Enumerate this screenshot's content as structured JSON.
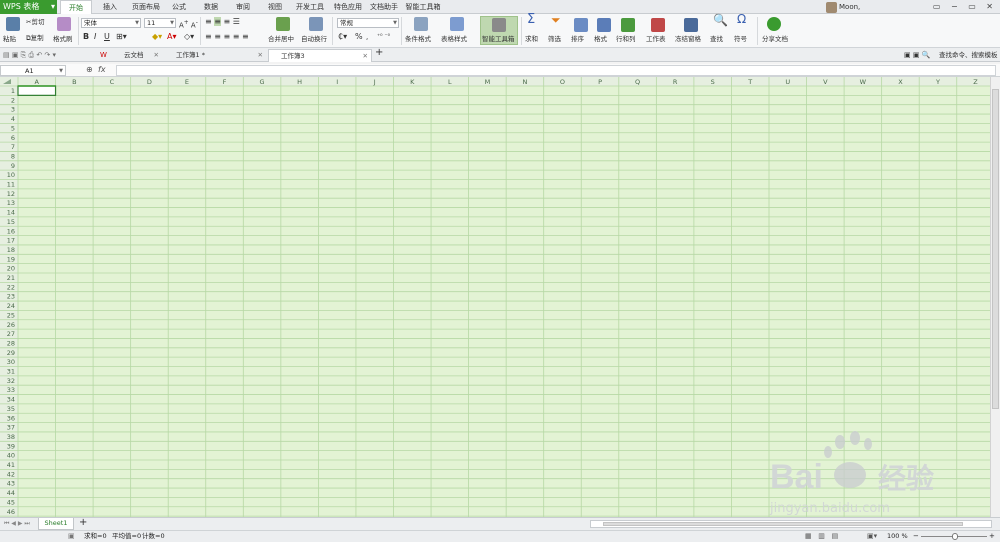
{
  "app": {
    "logo": "WPS 表格",
    "logo_dd": "▾"
  },
  "menu_tabs": [
    "开始",
    "插入",
    "页面布局",
    "公式",
    "数据",
    "审阅",
    "视图",
    "开发工具",
    "特色应用",
    "文档助手",
    "智能工具箱"
  ],
  "user": {
    "name": "Moon,"
  },
  "window_controls": "▭ − ▭ ✕",
  "ribbon": {
    "paste": "粘贴",
    "cut": "剪切",
    "copy": "复制",
    "format_painter": "格式刷",
    "font_name": "宋体",
    "font_size": "11",
    "bold": "B",
    "italic": "I",
    "underline": "U",
    "merge": "合并居中",
    "wrap": "自动换行",
    "number_format": "常规",
    "percent": "%",
    "cond_format": "条件格式",
    "table_style": "表格样式",
    "smart_toolbox": "智能工具箱",
    "sum": "求和",
    "filter": "筛选",
    "sort": "排序",
    "format": "格式",
    "rowcol": "行和列",
    "worksheet": "工作表",
    "freeze": "冻结窗格",
    "find": "查找",
    "symbol": "符号",
    "share": "分享文档"
  },
  "doc_tabs": {
    "cloud": "云文档",
    "book1": "工作簿1 *",
    "book3": "工作簿3"
  },
  "doc_search": "查找命令、搜索模板",
  "formula": {
    "cell_ref": "A1",
    "fx": "fx"
  },
  "columns": [
    "A",
    "B",
    "C",
    "D",
    "E",
    "F",
    "G",
    "H",
    "I",
    "J",
    "K",
    "L",
    "M",
    "N",
    "O",
    "P",
    "Q",
    "R",
    "S",
    "T",
    "U",
    "V",
    "W",
    "X",
    "Y",
    "Z"
  ],
  "row_count": 46,
  "sheet": {
    "name": "Sheet1",
    "add": "+"
  },
  "status": {
    "sum": "求和=0",
    "avg": "平均值=0",
    "count": "计数=0",
    "zoom": "100 %"
  },
  "watermark": {
    "brand": "Bai",
    "brand_cn": "经验",
    "url": "jingyan.baidu.com"
  },
  "colors": {
    "grid_fill": "#e3f3d4",
    "grid_line": "#b6d8a4",
    "header_fill": "#e6efe0",
    "accent": "#3a9b2f"
  }
}
